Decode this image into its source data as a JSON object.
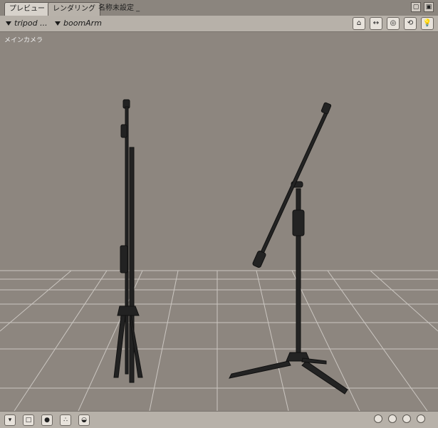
{
  "tabs": [
    {
      "label": "プレビュー",
      "active": true
    },
    {
      "label": "レンダリング",
      "active": false
    },
    {
      "label": "名称未設定 _",
      "active": false
    }
  ],
  "toolbar": {
    "figure_dropdown": "tripod ...",
    "actor_dropdown": "boomArm"
  },
  "viewport": {
    "camera_label": "メインカメラ"
  },
  "icons": {
    "tab_icons": [
      "window-minimize-icon",
      "window-close-icon"
    ],
    "toolbar_icons": [
      "camera-icon",
      "move-icon",
      "target-icon",
      "rotate-icon",
      "light-bulb-icon"
    ],
    "bottom_icons": [
      "menu-triangle-icon",
      "layout-icon",
      "sphere-icon",
      "particles-icon",
      "render-icon"
    ],
    "bottom_dots": [
      "dot-1",
      "dot-2",
      "dot-3",
      "dot-4"
    ]
  },
  "colors": {
    "viewport_bg": "#8d867f",
    "toolbar_bg": "#b7b1a9",
    "grid_line": "#d6d2cd"
  }
}
